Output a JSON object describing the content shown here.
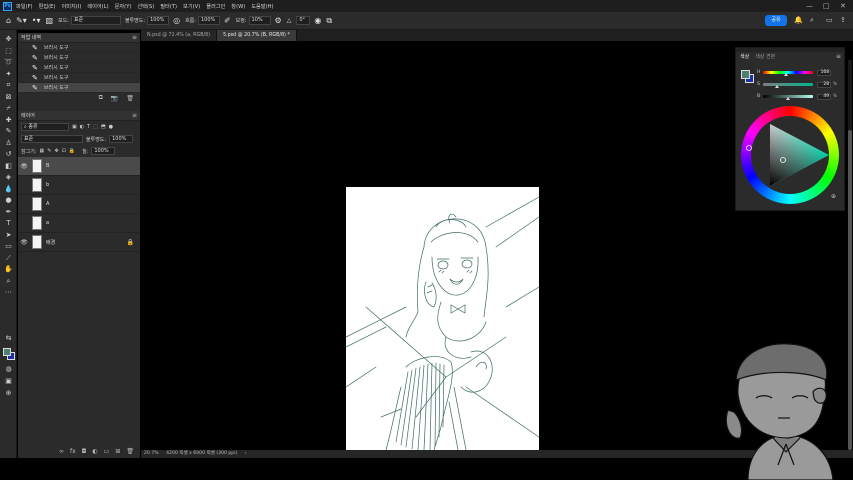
{
  "app": {
    "logo_text": "Ps",
    "menu": [
      "파일(F)",
      "편집(E)",
      "이미지(I)",
      "레이어(L)",
      "문자(Y)",
      "선택(S)",
      "필터(T)",
      "보기(V)",
      "플러그인",
      "창(W)",
      "도움말(H)"
    ]
  },
  "options": {
    "mode_label": "모드:",
    "mode_value": "표준",
    "opacity_label": "불투명도:",
    "opacity_value": "100%",
    "flow_label": "흐름:",
    "flow_value": "100%",
    "smoothing_label": "보정:",
    "smoothing_value": "10%",
    "angle_value": "0°",
    "share_label": "공유"
  },
  "history": {
    "title": "작업 내역",
    "items": [
      {
        "label": "브러시 도구"
      },
      {
        "label": "브러시 도구"
      },
      {
        "label": "브러시 도구"
      },
      {
        "label": "브러시 도구"
      },
      {
        "label": "브러시 도구"
      }
    ]
  },
  "layers": {
    "title": "레이어",
    "filter_value": "종류",
    "blend_value": "표준",
    "opacity_label": "불투명도:",
    "opacity_value": "100%",
    "lock_label": "잠그기:",
    "fill_label": "칠:",
    "fill_value": "100%",
    "items": [
      {
        "name": "B",
        "visible": true,
        "active": true
      },
      {
        "name": "b",
        "visible": false,
        "active": false
      },
      {
        "name": "A",
        "visible": false,
        "active": false
      },
      {
        "name": "a",
        "visible": false,
        "active": false
      },
      {
        "name": "배경",
        "visible": true,
        "active": false,
        "locked": true
      }
    ]
  },
  "tabs": [
    {
      "label": "N.psd @ 72.4% (a, RGB/8)",
      "active": false
    },
    {
      "label": "5.psd @ 20.7% (B, RGB/8) *",
      "active": true
    }
  ],
  "status": {
    "zoom": "20.7%",
    "doc_size": "4200 픽셀 x 6000 픽셀 (300 ppi)"
  },
  "color_panel": {
    "tab_color": "색상",
    "tab_swatches": "색상 견본",
    "h_label": "H",
    "h_value": "168",
    "s_label": "S",
    "s_value": "28",
    "s_unit": "%",
    "b_label": "B",
    "b_value": "49",
    "b_unit": "%",
    "h_fraction": 0.467,
    "s_fraction": 0.28,
    "b_fraction": 0.49
  },
  "colors": {
    "foreground": "#4d7f74",
    "background": "#1a2fa8",
    "accent": "#1473e6",
    "sketch_line": "#3b6b62"
  }
}
